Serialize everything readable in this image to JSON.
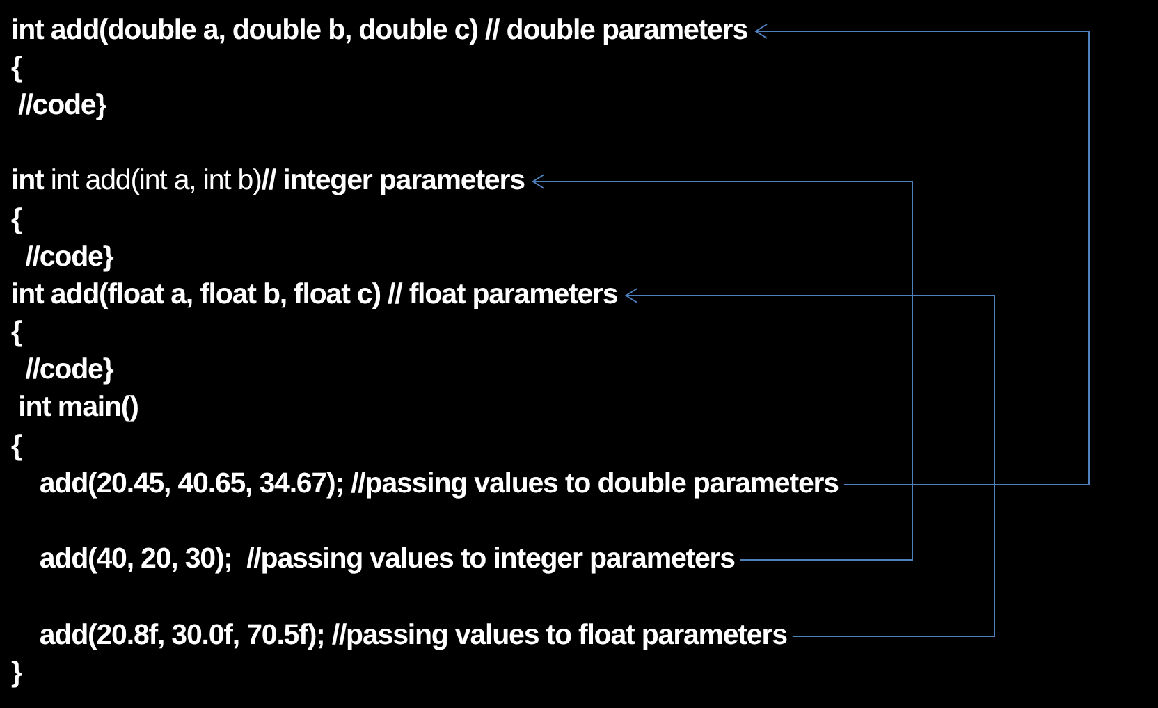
{
  "code_lines": [
    {
      "kind": "code",
      "text": "int add(double a, double b, double c) // double parameters",
      "bold": true
    },
    {
      "kind": "code",
      "text": "{",
      "bold": true
    },
    {
      "kind": "code",
      "text": " //code}",
      "bold": true
    },
    {
      "kind": "blank"
    },
    {
      "kind": "code",
      "text": "**int** int add(int a, int b)**// integer parameters**",
      "bold": false
    },
    {
      "kind": "code",
      "text": "{",
      "bold": true
    },
    {
      "kind": "code",
      "text": "  //code}",
      "bold": true
    },
    {
      "kind": "code",
      "text": "int add(float a, float b, float c) // float parameters",
      "bold": true
    },
    {
      "kind": "code",
      "text": "{",
      "bold": true
    },
    {
      "kind": "code",
      "text": "  //code}",
      "bold": true
    },
    {
      "kind": "code",
      "text": " int main()",
      "bold": true
    },
    {
      "kind": "code",
      "text": "{",
      "bold": true
    },
    {
      "kind": "code",
      "text": "    add(20.45, 40.65, 34.67); //passing values to double parameters",
      "bold": true
    },
    {
      "kind": "blank"
    },
    {
      "kind": "code",
      "text": "    add(40, 20, 30);  //passing values to integer parameters",
      "bold": true
    },
    {
      "kind": "blank"
    },
    {
      "kind": "code",
      "text": "    add(20.8f, 30.0f, 70.5f); //passing values to float parameters",
      "bold": true
    },
    {
      "kind": "code",
      "text": "}",
      "bold": true
    }
  ]
}
